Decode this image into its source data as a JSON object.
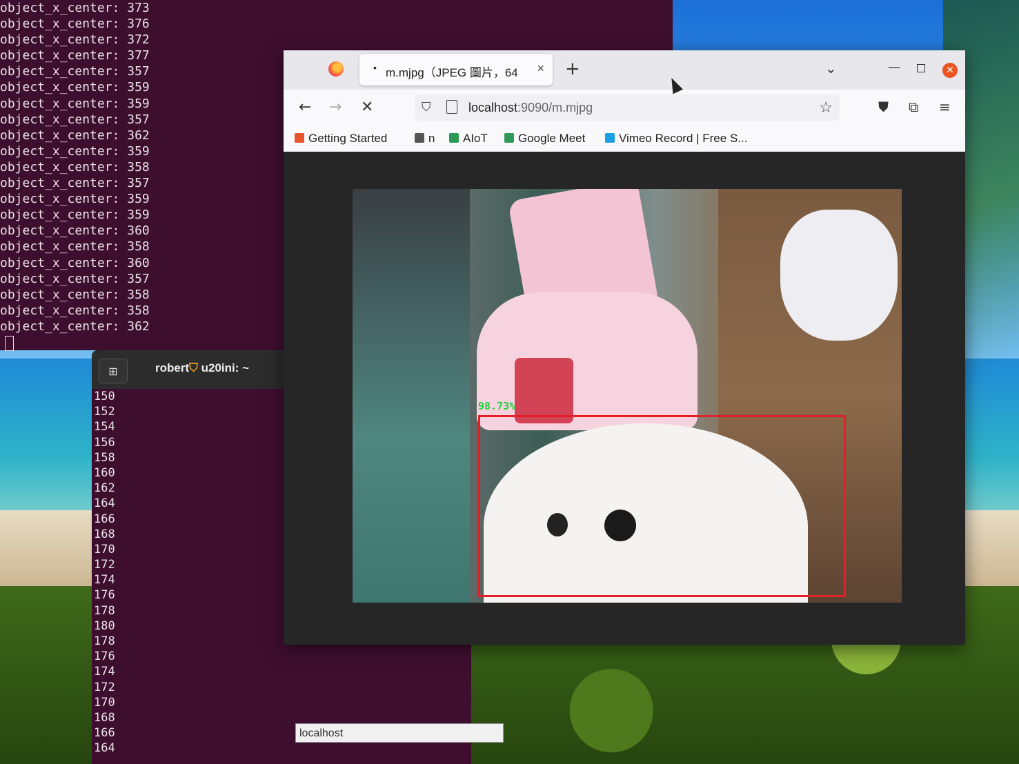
{
  "terminal_top": {
    "lines": [
      "object_x_center: 373",
      "object_x_center: 376",
      "object_x_center: 372",
      "object_x_center: 377",
      "object_x_center: 357",
      "object_x_center: 359",
      "object_x_center: 359",
      "object_x_center: 357",
      "object_x_center: 362",
      "object_x_center: 359",
      "object_x_center: 358",
      "object_x_center: 357",
      "object_x_center: 359",
      "object_x_center: 359",
      "object_x_center: 360",
      "object_x_center: 358",
      "object_x_center: 360",
      "object_x_center: 357",
      "object_x_center: 358",
      "object_x_center: 358",
      "object_x_center: 362"
    ]
  },
  "terminal_bottom": {
    "title": "robert",
    "host": "u20ini: ~",
    "lines": [
      "150",
      "152",
      "154",
      "156",
      "158",
      "160",
      "162",
      "164",
      "166",
      "168",
      "170",
      "172",
      "174",
      "176",
      "178",
      "180",
      "178",
      "176",
      "174",
      "172",
      "170",
      "168",
      "166",
      "164"
    ]
  },
  "browser": {
    "tab_title": "m.mjpg（JPEG 圖片，64",
    "url_host": "localhost",
    "url_rest": ":9090/m.mjpg",
    "bookmarks": [
      {
        "label": "Getting Started",
        "icon": "firefox-icon",
        "color": "#e8552b"
      },
      {
        "label": "n",
        "icon": "folder-icon",
        "color": "#555555"
      },
      {
        "label": "AIoT",
        "icon": "meet-icon",
        "color": "#2f9a57"
      },
      {
        "label": "Google Meet",
        "icon": "meet-icon",
        "color": "#2f9a57"
      },
      {
        "label": "Vimeo Record | Free S...",
        "icon": "vimeo-icon",
        "color": "#1a9fe0"
      }
    ],
    "detection_label": "98.73%",
    "status_text": "localhost"
  },
  "colors": {
    "terminal_bg": "#3e0e2f",
    "bbox": "#e3202a",
    "label": "#1fd33a",
    "close_button": "#e95420"
  }
}
